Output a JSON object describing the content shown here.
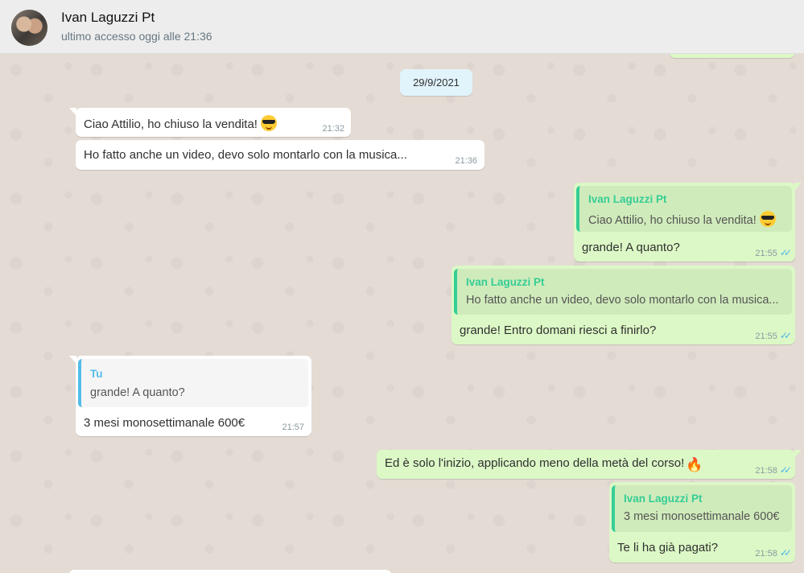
{
  "header": {
    "contact_name": "Ivan Laguzzi Pt",
    "status": "ultimo accesso oggi alle 21:36"
  },
  "chat": {
    "date": "29/9/2021",
    "messages": [
      {
        "text": "Ciao Attilio, ho chiuso la vendita!",
        "time": "21:32",
        "emoji": "smiling-face-with-sunglasses"
      },
      {
        "text": "Ho fatto anche un video, devo solo montarlo con la musica...",
        "time": "21:36"
      },
      {
        "quote_author": "Ivan Laguzzi Pt",
        "quote_text": "Ciao Attilio, ho chiuso la vendita!",
        "text": "grande! A quanto?",
        "time": "21:55",
        "status": "read"
      },
      {
        "quote_author": "Ivan Laguzzi Pt",
        "quote_text": "Ho fatto anche un video, devo solo montarlo con la musica...",
        "text": "grande! Entro domani riesci a finirlo?",
        "time": "21:55",
        "status": "read"
      },
      {
        "quote_author": "Tu",
        "quote_text": "grande! A quanto?",
        "text": "3 mesi monosettimanale 600€",
        "time": "21:57"
      },
      {
        "text": "Ed è solo l'inizio, applicando meno della metà del corso!",
        "time": "21:58",
        "emoji": "fire",
        "status": "read"
      },
      {
        "quote_author": "Ivan Laguzzi Pt",
        "quote_text": "3 mesi monosettimanale 600€",
        "text": "Te li ha già pagati?",
        "time": "21:58",
        "status": "read"
      }
    ]
  },
  "colors": {
    "incoming": "#ffffff",
    "outgoing": "#dcf8c6",
    "quote_accent_outgoing": "#35cd96",
    "quote_accent_incoming": "#53bdeb",
    "read_ticks": "#4fb6ec",
    "date_chip": "#e1f3fb"
  }
}
